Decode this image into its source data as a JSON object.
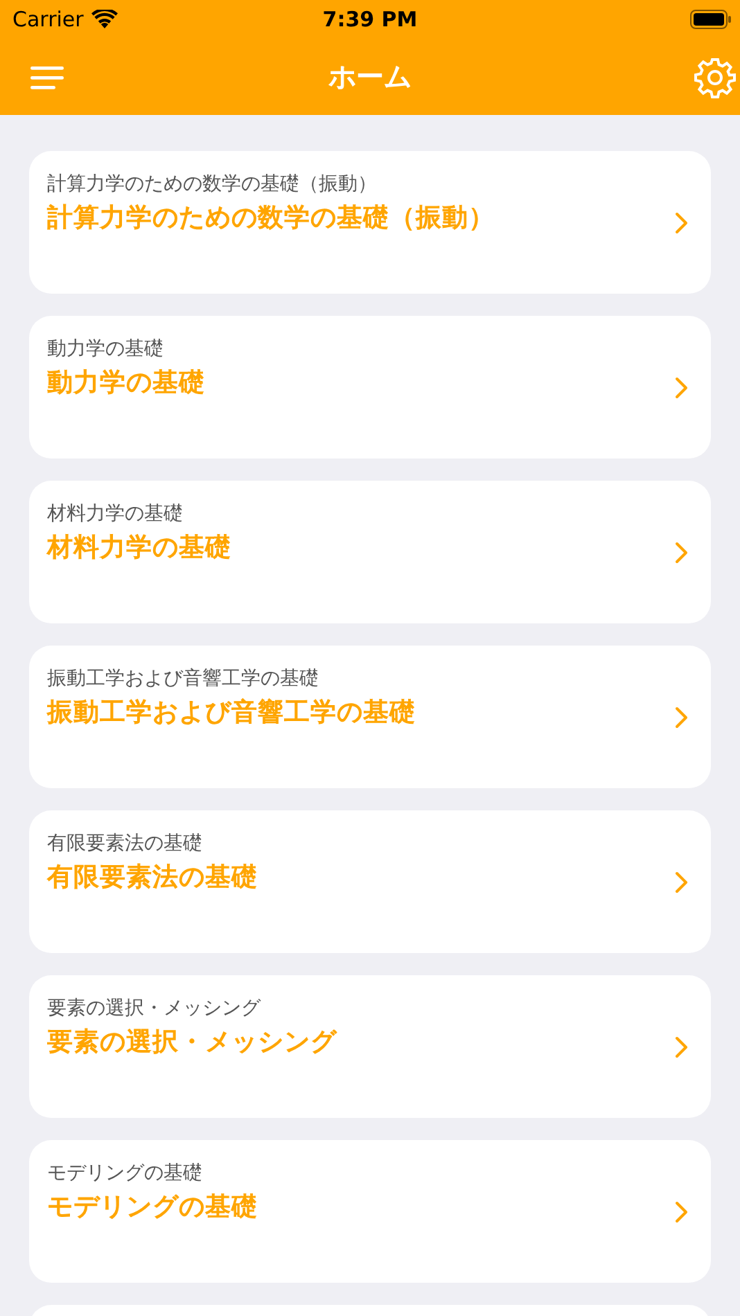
{
  "status_bar": {
    "carrier": "Carrier",
    "time": "7:39 PM"
  },
  "nav_bar": {
    "title": "ホーム"
  },
  "cards": [
    {
      "subtitle": "計算力学のための数学の基礎（振動）",
      "title": "計算力学のための数学の基礎（振動）"
    },
    {
      "subtitle": "動力学の基礎",
      "title": "動力学の基礎"
    },
    {
      "subtitle": "材料力学の基礎",
      "title": "材料力学の基礎"
    },
    {
      "subtitle": "振動工学および音響工学の基礎",
      "title": "振動工学および音響工学の基礎"
    },
    {
      "subtitle": "有限要素法の基礎",
      "title": "有限要素法の基礎"
    },
    {
      "subtitle": "要素の選択・メッシング",
      "title": "要素の選択・メッシング"
    },
    {
      "subtitle": "モデリングの基礎",
      "title": "モデリングの基礎"
    }
  ],
  "more_cards_below": true
}
